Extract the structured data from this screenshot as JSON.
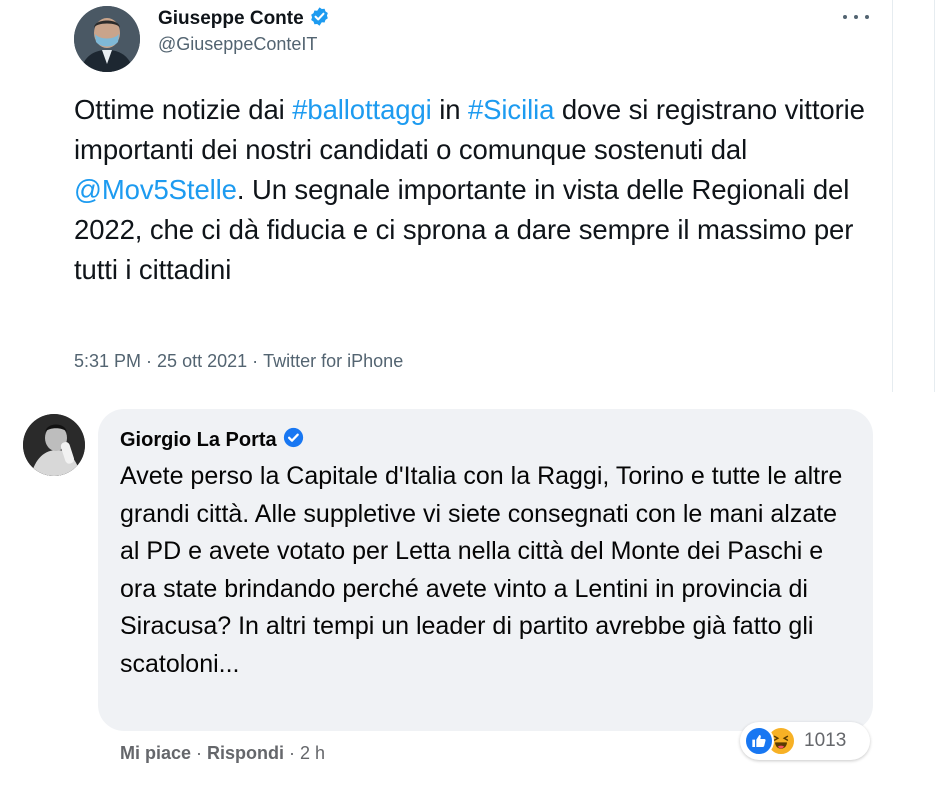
{
  "tweet": {
    "author_name": "Giuseppe Conte",
    "author_handle": "@GiuseppeConteIT",
    "text_segments": [
      {
        "text": "Ottime notizie dai ",
        "link": false
      },
      {
        "text": "#ballottaggi",
        "link": true
      },
      {
        "text": " in ",
        "link": false
      },
      {
        "text": "#Sicilia",
        "link": true
      },
      {
        "text": " dove si registrano vittorie importanti dei nostri candidati o comunque sostenuti dal ",
        "link": false
      },
      {
        "text": "@Mov5Stelle",
        "link": true
      },
      {
        "text": ". Un segnale importante in vista delle Regionali del 2022, che ci dà fiducia e ci sprona a dare sempre il massimo per tutti i cittadini",
        "link": false
      }
    ],
    "time": "5:31 PM",
    "date": "25 ott 2021",
    "source": "Twitter for iPhone",
    "meta_separator": "·",
    "icons": {
      "verified": "verified-badge-icon",
      "more": "more-options-icon"
    },
    "colors": {
      "link": "#1d9bf0",
      "secondary": "#536471",
      "verified": "#1d9bf0"
    }
  },
  "comment": {
    "author_name": "Giorgio La Porta",
    "text": "Avete perso la Capitale d'Italia con la Raggi, Torino e tutte le altre grandi città. Alle suppletive vi siete consegnati con le mani alzate al PD e avete votato per Letta nella città del Monte dei Paschi e ora state brindando perché avete vinto a Lentini in provincia di Siracusa? In altri tempi un leader di partito avrebbe già fatto gli scatoloni...",
    "like_label": "Mi piace",
    "reply_label": "Rispondi",
    "separator": "·",
    "time_ago": "2 h",
    "reaction_count": "1013",
    "reactions": [
      "like-icon",
      "haha-icon"
    ],
    "colors": {
      "bubble": "#f0f2f5",
      "like": "#1877f2",
      "haha": "#f7b125",
      "secondary": "#65676b"
    }
  }
}
